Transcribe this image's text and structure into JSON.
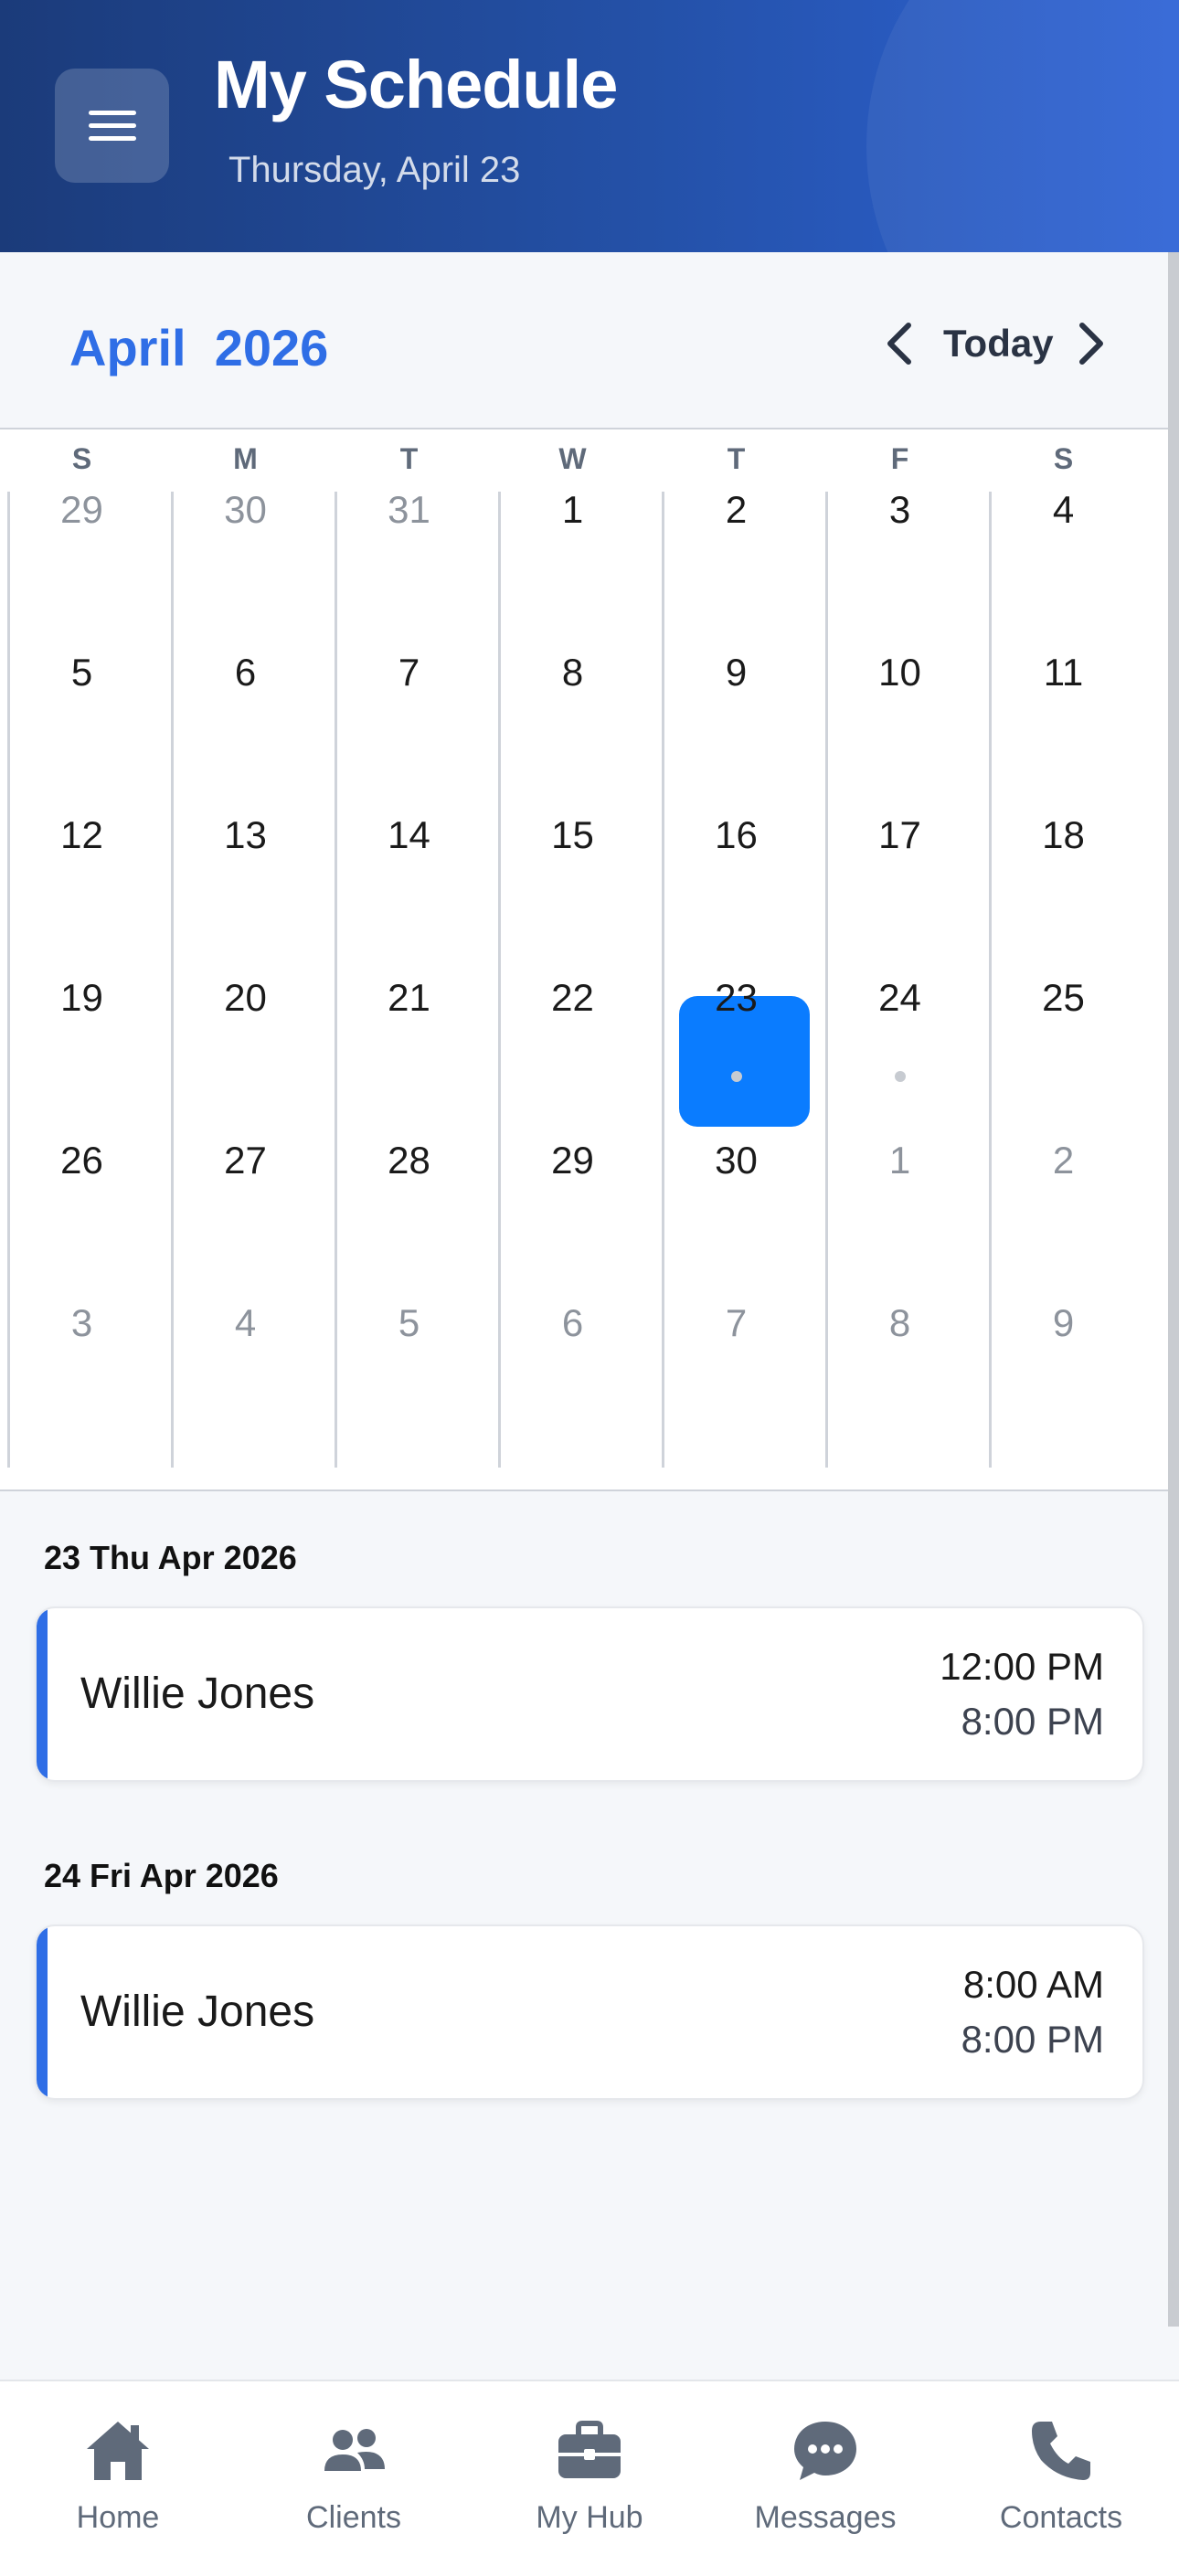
{
  "header": {
    "title": "My Schedule",
    "subtitle": "Thursday, April 23"
  },
  "month_nav": {
    "month": "April",
    "year": "2026",
    "today_label": "Today"
  },
  "calendar": {
    "weekdays": [
      "S",
      "M",
      "T",
      "W",
      "T",
      "F",
      "S"
    ],
    "weeks": [
      [
        "29",
        "30",
        "31",
        "1",
        "2",
        "3",
        "4"
      ],
      [
        "5",
        "6",
        "7",
        "8",
        "9",
        "10",
        "11"
      ],
      [
        "12",
        "13",
        "14",
        "15",
        "16",
        "17",
        "18"
      ],
      [
        "19",
        "20",
        "21",
        "22",
        "23",
        "24",
        "25"
      ],
      [
        "26",
        "27",
        "28",
        "29",
        "30",
        "1",
        "2"
      ],
      [
        "3",
        "4",
        "5",
        "6",
        "7",
        "8",
        "9"
      ]
    ],
    "selected_day": "23"
  },
  "events": [
    {
      "date_label": "23 Thu Apr 2026",
      "name": "Willie Jones",
      "start": "12:00 PM",
      "end": "8:00 PM"
    },
    {
      "date_label": "24 Fri Apr 2026",
      "name": "Willie Jones",
      "start": "8:00 AM",
      "end": "8:00 PM"
    }
  ],
  "bottom_nav": [
    {
      "label": "Home",
      "icon": "home-icon"
    },
    {
      "label": "Clients",
      "icon": "users-icon"
    },
    {
      "label": "My Hub",
      "icon": "briefcase-icon"
    },
    {
      "label": "Messages",
      "icon": "chat-bubble-icon"
    },
    {
      "label": "Contacts",
      "icon": "phone-icon"
    }
  ],
  "colors": {
    "accent": "#2f6ee6",
    "selected": "#0a7cff",
    "header_start": "#1b3b7a",
    "header_end": "#2e63d6"
  }
}
